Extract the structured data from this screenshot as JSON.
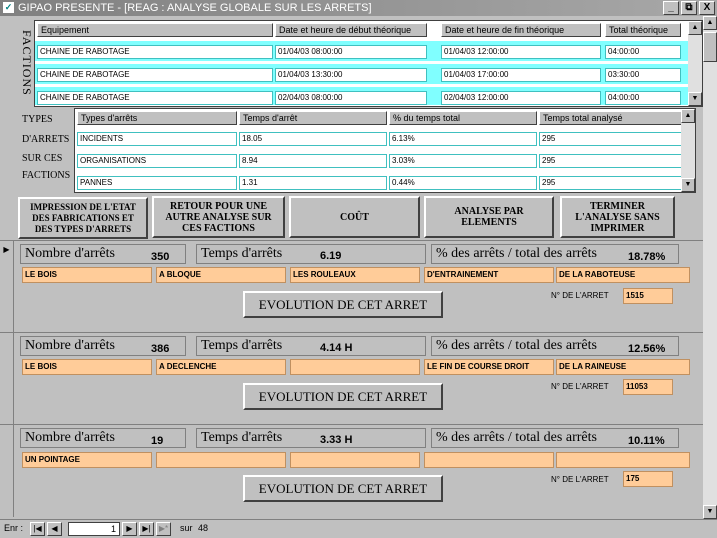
{
  "window": {
    "title": "GIPAO PRESENTE - [REAG : ANALYSE GLOBALE SUR LES ARRETS]",
    "buttons": [
      "_",
      "⧉",
      "X"
    ]
  },
  "factions": {
    "vlabel": "FACTIONS",
    "headers": [
      "Equipement",
      "Date et heure de début théorique",
      "Date et heure de fin théorique",
      "Total théorique"
    ],
    "rows": [
      [
        "CHAINE DE RABOTAGE",
        "01/04/03 08:00:00",
        "01/04/03 12:00:00",
        "04:00:00"
      ],
      [
        "CHAINE DE RABOTAGE",
        "01/04/03 13:30:00",
        "01/04/03 17:00:00",
        "03:30:00"
      ],
      [
        "CHAINE DE RABOTAGE",
        "02/04/03 08:00:00",
        "02/04/03 12:00:00",
        "04:00:00"
      ]
    ]
  },
  "types": {
    "label_lines": [
      "TYPES",
      "D'ARRETS",
      "SUR CES",
      "FACTIONS"
    ],
    "headers": [
      "Types d'arrêts",
      "Temps d'arrêt",
      "% du temps total",
      "Temps total analysé"
    ],
    "rows": [
      [
        "INCIDENTS",
        "18.05",
        "6.13%",
        "295"
      ],
      [
        "ORGANISATIONS",
        "8.94",
        "3.03%",
        "295"
      ],
      [
        "PANNES",
        "1.31",
        "0.44%",
        "295"
      ]
    ]
  },
  "actions": [
    "IMPRESSION DE L'ETAT DES FABRICATIONS ET DES TYPES D'ARRETS",
    "RETOUR POUR UNE AUTRE ANALYSE SUR CES FACTIONS",
    "COÛT",
    "ANALYSE PAR ELEMENTS",
    "TERMINER L'ANALYSE SANS IMPRIMER"
  ],
  "labels": {
    "nombre": "Nombre d'arrêts",
    "temps": "Temps d'arrêts",
    "pct": "% des arrêts / total des arrêts",
    "evolution": "EVOLUTION DE CET ARRET",
    "numero": "N° DE L'ARRET"
  },
  "records": [
    {
      "selector": "▶",
      "nombre": "350",
      "temps": "6.19",
      "pct": "18.78%",
      "elements": [
        "LE BOIS",
        "A BLOQUE",
        "LES ROULEAUX",
        "D'ENTRAINEMENT",
        "DE LA RABOTEUSE"
      ],
      "numero": "1515"
    },
    {
      "selector": "",
      "nombre": "386",
      "temps": "4.14 H",
      "pct": "12.56%",
      "elements": [
        "LE BOIS",
        "A DECLENCHE",
        "",
        "LE FIN DE COURSE DROIT",
        "DE LA RAINEUSE"
      ],
      "numero": "11053"
    },
    {
      "selector": "",
      "nombre": "19",
      "temps": "3.33 H",
      "pct": "10.11%",
      "elements": [
        "UN POINTAGE",
        "",
        "",
        "",
        ""
      ],
      "numero": "175"
    }
  ],
  "nav": {
    "label": "Enr :",
    "current": "1",
    "of_label": "sur",
    "total": "48",
    "buttons": [
      "|◀",
      "◀",
      "▶",
      "▶|",
      "▶*"
    ]
  }
}
